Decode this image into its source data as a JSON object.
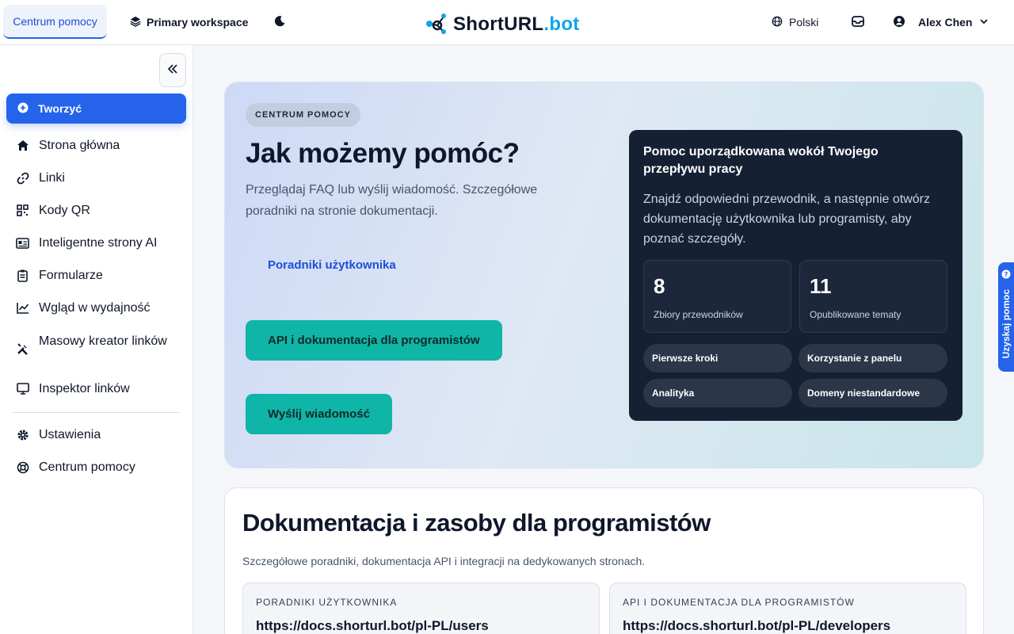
{
  "topbar": {
    "help_tab": "Centrum pomocy",
    "workspace": "Primary workspace",
    "brand_a": "ShortURL",
    "brand_b": ".bot",
    "language": "Polski",
    "user_name": "Alex Chen"
  },
  "sidebar": {
    "create": "Tworzyć",
    "items": [
      {
        "label": "Strona główna",
        "icon": "home-icon"
      },
      {
        "label": "Linki",
        "icon": "link-icon"
      },
      {
        "label": "Kody QR",
        "icon": "qr-icon"
      },
      {
        "label": "Inteligentne strony AI",
        "icon": "id-card-icon"
      },
      {
        "label": "Formularze",
        "icon": "clipboard-icon"
      },
      {
        "label": "Wgląd w wydajność",
        "icon": "chart-icon"
      },
      {
        "label": "Masowy kreator linków",
        "icon": "tools-icon"
      },
      {
        "label": "Inspektor linków",
        "icon": "monitor-icon"
      }
    ],
    "bottom": [
      {
        "label": "Ustawienia",
        "icon": "gear-icon"
      },
      {
        "label": "Centrum pomocy",
        "icon": "lifebuoy-icon"
      }
    ]
  },
  "hero": {
    "badge": "CENTRUM POMOCY",
    "title": "Jak możemy pomóc?",
    "subtitle": "Przeglądaj FAQ lub wyślij wiadomość. Szczegółowe poradniki na stronie dokumentacji.",
    "guides_link": "Poradniki użytkownika",
    "api_button": "API i dokumentacja dla programistów",
    "message_button": "Wyślij wiadomość",
    "card": {
      "title": "Pomoc uporządkowana wokół Twojego przepływu pracy",
      "text": "Znajdź odpowiedni przewodnik, a następnie otwórz dokumentację użytkownika lub programisty, aby poznać szczegóły.",
      "stats": [
        {
          "value": "8",
          "label": "Zbiory przewodników"
        },
        {
          "value": "11",
          "label": "Opublikowane tematy"
        }
      ],
      "chips": [
        "Pierwsze kroki",
        "Korzystanie z panelu",
        "Analityka",
        "Domeny niestandardowe"
      ]
    }
  },
  "docs": {
    "title": "Dokumentacja i zasoby dla programistów",
    "subtitle": "Szczegółowe poradniki, dokumentacja API i integracji na dedykowanych stronach.",
    "cards": [
      {
        "kicker": "PORADNIKI UŻYTKOWNIKA",
        "url": "https://docs.shorturl.bot/pl-PL/users"
      },
      {
        "kicker": "API I DOKUMENTACJA DLA PROGRAMISTÓW",
        "url": "https://docs.shorturl.bot/pl-PL/developers"
      }
    ]
  },
  "side_tab": "Uzyskaj pomoc",
  "colors": {
    "accent": "#2563eb",
    "teal": "#0fb5a6",
    "dark": "#162033"
  }
}
